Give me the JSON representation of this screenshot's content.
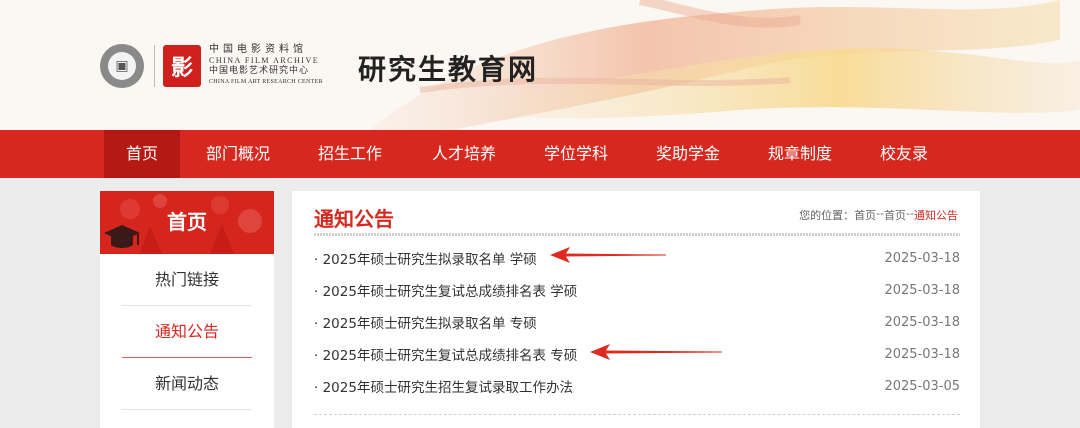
{
  "header": {
    "site_title": "研究生教育网",
    "archive_cn": "中国电影资料馆",
    "archive_en": "CHINA FILM ARCHIVE",
    "center_cn": "中国电影艺术研究中心",
    "center_en": "CHINA FILM ART RESEARCH CENTER",
    "red_logo_glyph": "影"
  },
  "nav": {
    "items": [
      {
        "label": "首页",
        "active": true
      },
      {
        "label": "部门概况"
      },
      {
        "label": "招生工作"
      },
      {
        "label": "人才培养"
      },
      {
        "label": "学位学科"
      },
      {
        "label": "奖助学金"
      },
      {
        "label": "规章制度"
      },
      {
        "label": "校友录"
      }
    ]
  },
  "sidebar": {
    "title": "首页",
    "items": [
      {
        "label": "热门链接"
      },
      {
        "label": "通知公告",
        "active": true
      },
      {
        "label": "新闻动态"
      }
    ]
  },
  "content": {
    "title": "通知公告",
    "breadcrumb": {
      "prefix": "您的位置：",
      "home": "首页",
      "sep": "--",
      "parent": "首页",
      "current": "通知公告"
    },
    "notices": [
      {
        "title": "2025年硕士研究生拟录取名单 学硕",
        "date": "2025-03-18"
      },
      {
        "title": "2025年硕士研究生复试总成绩排名表 学硕",
        "date": "2025-03-18"
      },
      {
        "title": "2025年硕士研究生拟录取名单 专硕",
        "date": "2025-03-18"
      },
      {
        "title": "2025年硕士研究生复试总成绩排名表 专硕",
        "date": "2025-03-18"
      },
      {
        "title": "2025年硕士研究生招生复试录取工作办法",
        "date": "2025-03-05"
      }
    ],
    "bullet": "·"
  },
  "colors": {
    "brand_red": "#d7281f",
    "nav_active": "#b41913"
  }
}
